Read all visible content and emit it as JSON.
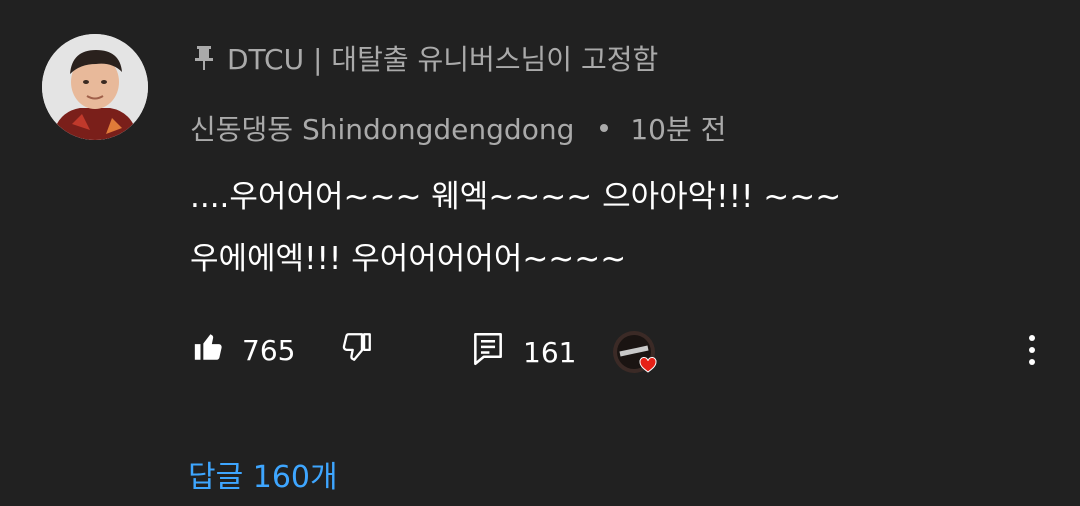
{
  "pinned": {
    "label": "DTCU | 대탈출 유니버스님이 고정함",
    "icon": "pin-icon"
  },
  "author": {
    "name": "신동댕동 Shindongdengdong",
    "time": "10분 전"
  },
  "comment": {
    "line1": "....우어어어~~~ 웨엑~~~~ 으아아악!!! ~~~",
    "line2": "우에에엑!!! 우어어어어어~~~~"
  },
  "actions": {
    "likes": "765",
    "replies": "161"
  },
  "reply_link": "답글 160개",
  "colors": {
    "background": "#212121",
    "secondary_text": "#aaaaaa",
    "link": "#3ea6ff",
    "heart": "#e62117"
  }
}
